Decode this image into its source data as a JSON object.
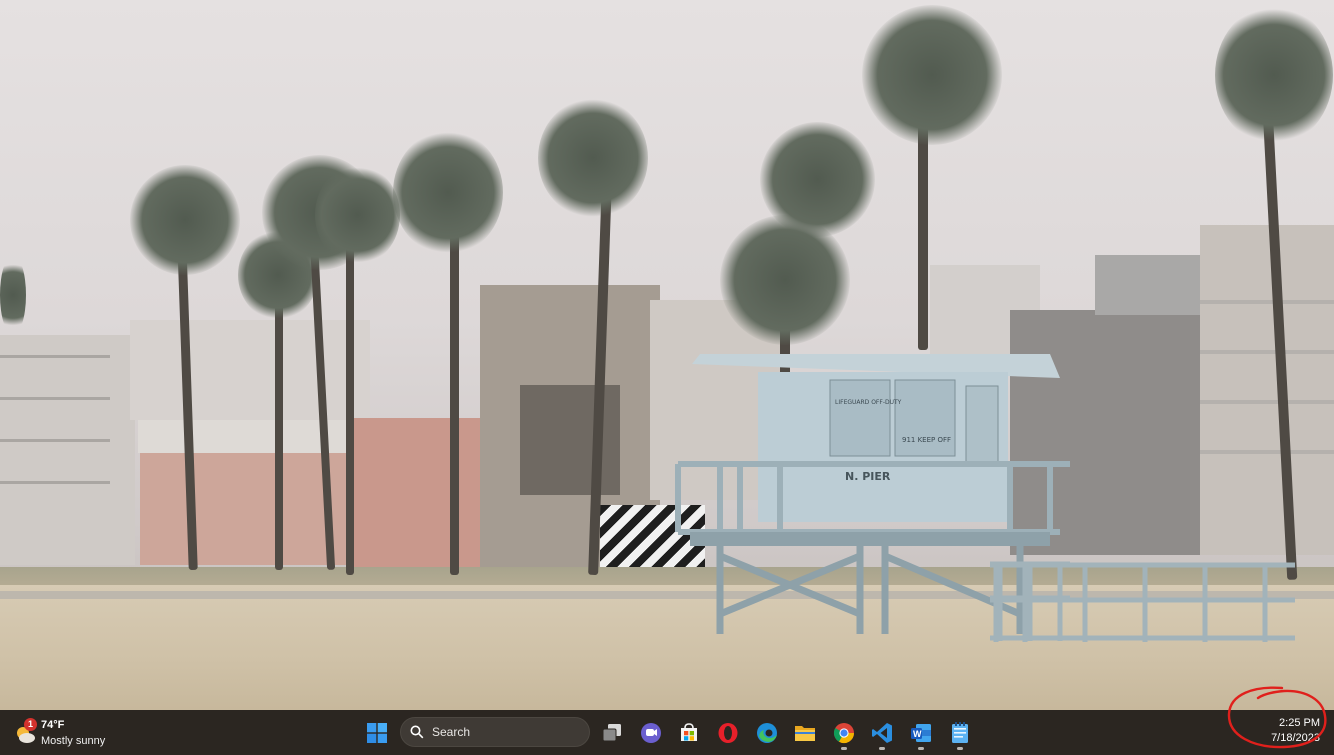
{
  "weather": {
    "temperature": "74°F",
    "condition": "Mostly sunny",
    "badge_count": "1",
    "icon": "partly-sunny-icon"
  },
  "search": {
    "label": "Search"
  },
  "taskbar_apps": [
    {
      "name": "start",
      "icon": "windows-logo-icon"
    },
    {
      "name": "task-view",
      "icon": "task-view-icon"
    },
    {
      "name": "teams-chat",
      "icon": "teams-chat-icon"
    },
    {
      "name": "microsoft-store",
      "icon": "store-icon"
    },
    {
      "name": "opera",
      "icon": "opera-icon"
    },
    {
      "name": "edge",
      "icon": "edge-icon"
    },
    {
      "name": "file-explorer",
      "icon": "folder-icon"
    },
    {
      "name": "chrome",
      "icon": "chrome-icon"
    },
    {
      "name": "vs-code",
      "icon": "vscode-icon"
    },
    {
      "name": "word",
      "icon": "word-icon"
    },
    {
      "name": "notepad",
      "icon": "notepad-icon"
    }
  ],
  "clock": {
    "time": "2:25 PM",
    "date": "7/18/2023"
  },
  "colors": {
    "taskbar_bg": "#2b2621",
    "annotation": "#e0201c",
    "accent": "#3a8ee6"
  },
  "wallpaper": {
    "tower_text_1": "LIFEGUARD OFF-DUTY",
    "tower_text_2": "911 KEEP OFF",
    "tower_sign": "N. PIER"
  }
}
